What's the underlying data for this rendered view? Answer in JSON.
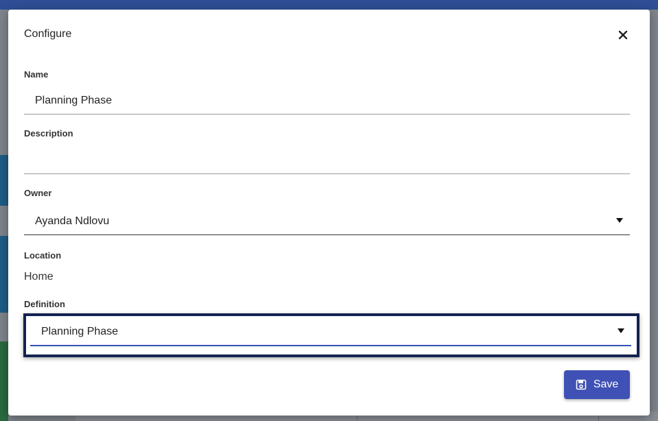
{
  "dialog": {
    "title": "Configure",
    "close_icon": "close-icon",
    "fields": {
      "name": {
        "label": "Name",
        "value": "Planning Phase"
      },
      "description": {
        "label": "Description",
        "value": ""
      },
      "owner": {
        "label": "Owner",
        "value": "Ayanda Ndlovu",
        "icon": "chevron-down-icon"
      },
      "location": {
        "label": "Location",
        "value": "Home"
      },
      "definition": {
        "label": "Definition",
        "value": "Planning Phase",
        "icon": "chevron-down-icon"
      }
    },
    "save_button": {
      "label": "Save",
      "icon": "save-icon"
    }
  },
  "colors": {
    "primary": "#3f51b5",
    "highlight_border": "#14224f",
    "header_bar": "#2f4e96"
  }
}
